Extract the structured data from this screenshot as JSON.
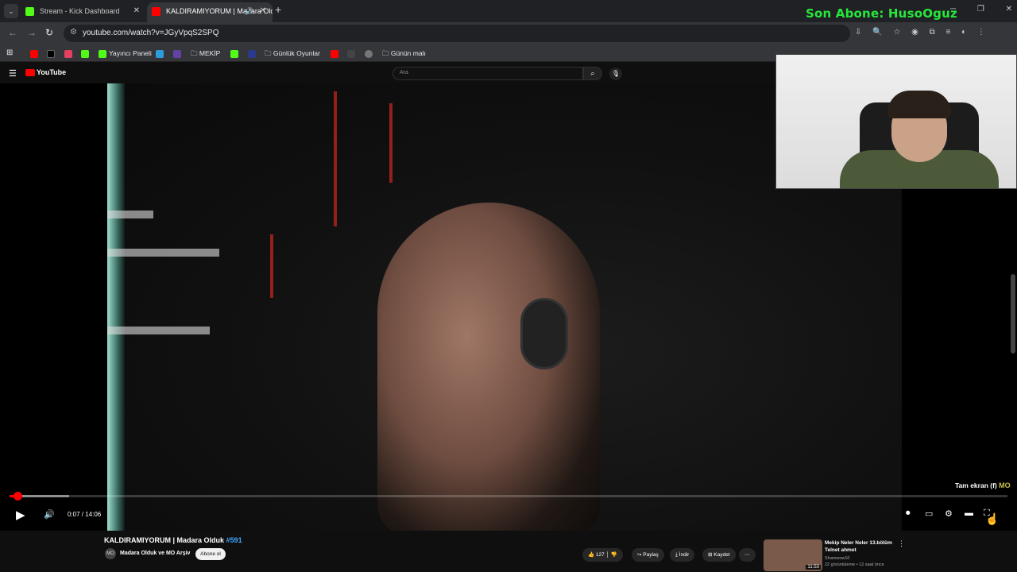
{
  "browser": {
    "tabs": [
      {
        "title": "Stream - Kick Dashboard",
        "favicon_color": "#53fc18"
      },
      {
        "title": "KALDIRAMIYORUM | Madara Olduk",
        "favicon_color": "#ff0000"
      }
    ],
    "url": "youtube.com/watch?v=JGyVpqS2SPQ",
    "bookmarks": [
      {
        "label": "",
        "icon_color": "#ff0000"
      },
      {
        "label": "",
        "icon_color": "#000000"
      },
      {
        "label": "",
        "icon_color": "#e4405f"
      },
      {
        "label": "",
        "icon_color": "#53fc18"
      },
      {
        "label": "Yayıncı Paneli",
        "icon_color": "#53fc18"
      },
      {
        "label": "",
        "icon_color": "#2d9cdb"
      },
      {
        "label": "",
        "icon_color": "#6441a5"
      },
      {
        "label": "MEKİP",
        "icon": "folder-icon"
      },
      {
        "label": "",
        "icon_color": "#53fc18"
      },
      {
        "label": "",
        "icon_color": "#2b3a8c"
      },
      {
        "label": "Günlük Oyunlar",
        "icon": "folder-icon"
      },
      {
        "label": "",
        "icon_color": "#ff0000"
      },
      {
        "label": "",
        "icon_color": "#444444"
      },
      {
        "label": "",
        "icon_color": "#777777"
      },
      {
        "label": "Günün malı",
        "icon": "folder-icon"
      }
    ]
  },
  "overlay": {
    "subscriber_banner": "Son Abone: HusoOguz",
    "banner_color": "#26e83c"
  },
  "youtube": {
    "logo": "YouTube",
    "search_placeholder": "Ara"
  },
  "player": {
    "current_time": "0:07",
    "duration": "14:06",
    "time_display": "0:07 / 14:06",
    "progress_fraction": 0.0083,
    "buffered_fraction": 0.06,
    "fullscreen_tooltip": "Tam ekran (f)",
    "watermark": "MO"
  },
  "video_info": {
    "title": "KALDIRAMIYORUM | Madara Olduk",
    "title_tag": "#591",
    "channel": "Madara Olduk ve MO Arşiv",
    "subscribe_label": "Abone ol",
    "likes": "127",
    "share_label": "Paylaş",
    "download_label": "İndir",
    "save_label": "Kaydet"
  },
  "recommendation": {
    "title": "Mekip Neler Neler 13.bölüm Telnet ahmet",
    "channel": "Shamwow10",
    "meta": "22 görüntüleme • 12 saat önce",
    "duration": "11:53"
  }
}
